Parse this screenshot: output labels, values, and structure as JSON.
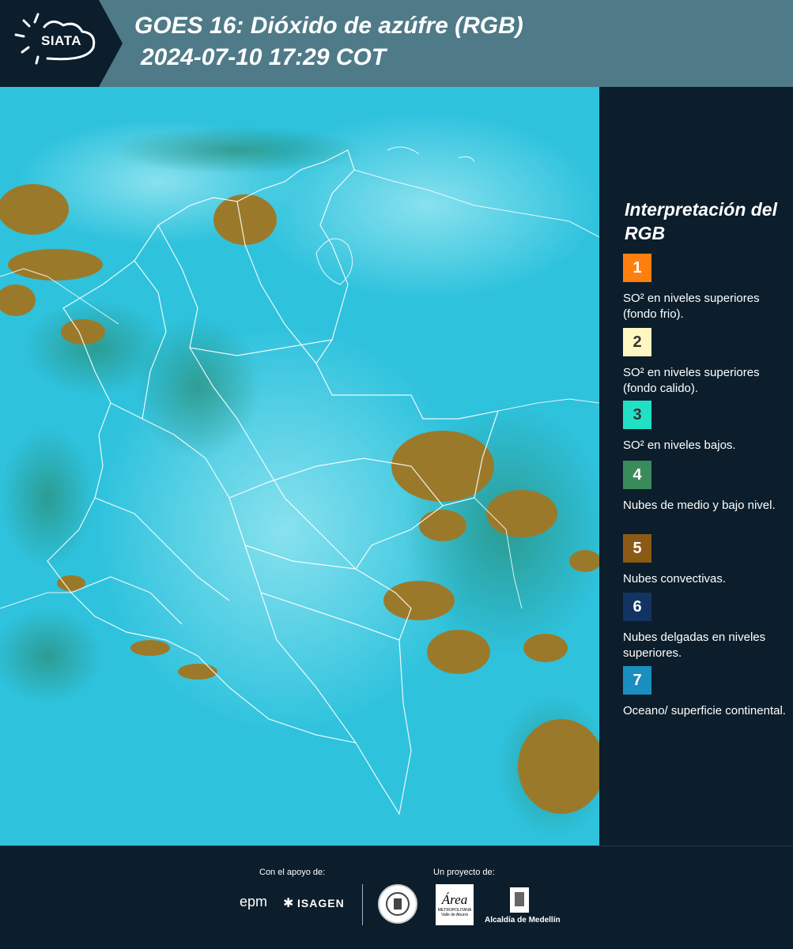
{
  "header": {
    "logo_text": "SIATA",
    "title": "GOES 16: Dióxido de azúfre (RGB)",
    "subtitle": "2024-07-10 17:29 COT"
  },
  "legend": {
    "title": "Interpretación del RGB",
    "items": [
      {
        "number": "1",
        "label": "SO² en niveles superiores (fondo frio).",
        "color": "#ff7f0e"
      },
      {
        "number": "2",
        "label": "SO² en niveles superiores (fondo calido).",
        "color": "#fff7c2"
      },
      {
        "number": "3",
        "label": "SO² en niveles bajos.",
        "color": "#22e0c6"
      },
      {
        "number": "4",
        "label": "Nubes de medio y bajo nivel.",
        "color": "#3a8a5c"
      },
      {
        "number": "5",
        "label": "Nubes convectivas.",
        "color": "#8b5a14"
      },
      {
        "number": "6",
        "label": "Nubes delgadas en niveles superiores.",
        "color": "#123462"
      },
      {
        "number": "7",
        "label": "Oceano/ superficie continental.",
        "color": "#1a8fbf"
      }
    ]
  },
  "footer": {
    "support_label": "Con el apoyo de:",
    "project_label": "Un proyecto de:",
    "epm": "epm",
    "isagen": "ISAGEN",
    "area_name": "Área",
    "area_sub": "METROPOLITANA",
    "area_sub2": "Valle de Aburrá",
    "alcaldia": "Alcaldía de Medellín"
  }
}
